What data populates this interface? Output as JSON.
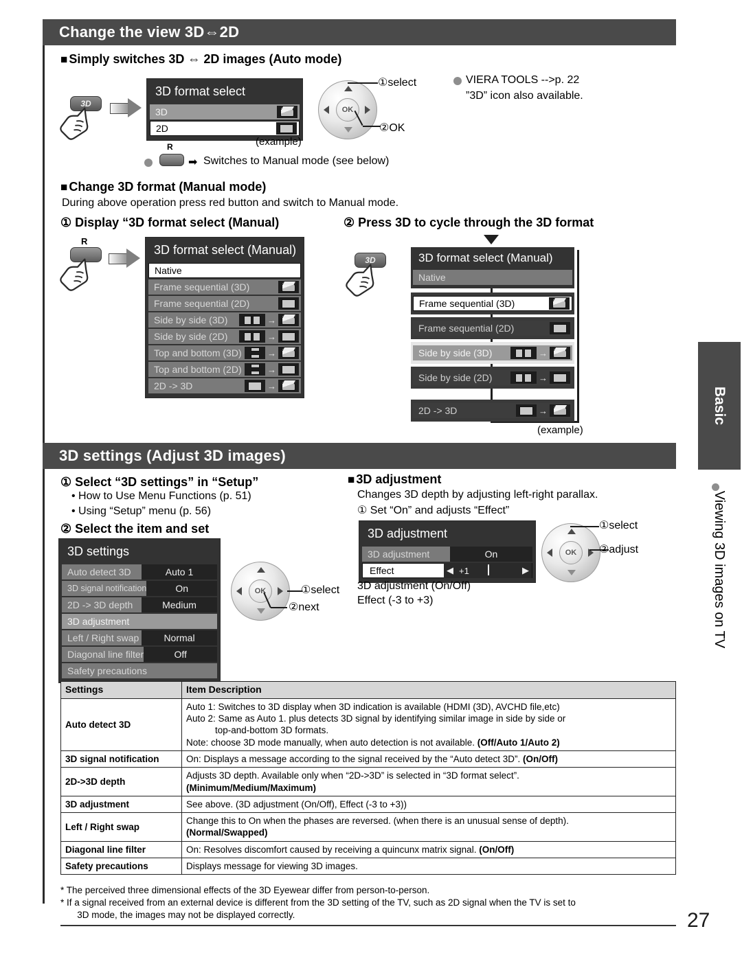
{
  "page": {
    "number": "27"
  },
  "side": {
    "tab_label": "Basic",
    "vertical_label": "Viewing 3D images on TV"
  },
  "section1": {
    "title": "Change the view 3D⇔2D",
    "sub1": "Simply switches 3D ⇔ 2D images (Auto mode)",
    "osd_auto": {
      "title": "3D format select",
      "rows": [
        {
          "label": "3D",
          "glyph": "cube-icon"
        },
        {
          "label": "2D",
          "glyph": "flat-icon"
        }
      ],
      "caption": "(example)"
    },
    "wheel1": {
      "ok_label": "OK",
      "callout1": "①select",
      "callout2": "②OK"
    },
    "note_viera": "VIERA TOOLS -->p. 22",
    "note_viera2": "”3D” icon also available.",
    "red_button_label": "R",
    "switch_manual_text": "Switches to Manual mode (see below)",
    "button_3d_label": "3D",
    "sub2": "Change 3D format (Manual mode)",
    "sub2_body": "During above operation press red button and switch to Manual mode.",
    "step1": "① Display “3D format select (Manual)",
    "step2": "② Press 3D to cycle through the 3D format",
    "osd_manual": {
      "title": "3D format select (Manual)",
      "rows": [
        {
          "label": "Native",
          "style": "selected",
          "glyphs": []
        },
        {
          "label": "Frame sequential (3D)",
          "style": "normal",
          "glyphs": [
            "cube-icon"
          ]
        },
        {
          "label": "Frame sequential (2D)",
          "style": "normal",
          "glyphs": [
            "flat-icon"
          ]
        },
        {
          "label": "Side by side (3D)",
          "style": "normal",
          "glyphs": [
            "half-half-icon",
            "arrow-icon",
            "cube-icon"
          ]
        },
        {
          "label": "Side by side (2D)",
          "style": "normal",
          "glyphs": [
            "half-half-icon",
            "arrow-icon",
            "flat-icon"
          ]
        },
        {
          "label": "Top and bottom (3D)",
          "style": "normal",
          "glyphs": [
            "stack-icon",
            "arrow-icon",
            "cube-icon"
          ]
        },
        {
          "label": "Top and bottom (2D)",
          "style": "normal",
          "glyphs": [
            "stack-icon",
            "arrow-icon",
            "flat-icon"
          ]
        },
        {
          "label": "2D -> 3D",
          "style": "normal",
          "glyphs": [
            "flat-icon",
            "arrow-icon",
            "cube-icon"
          ]
        }
      ]
    },
    "osd_cycle": {
      "title": "3D format select (Manual)",
      "rows": [
        {
          "label": "Native",
          "style": "normal",
          "glyphs": []
        },
        {
          "label": "Frame sequential (3D)",
          "style": "selected",
          "glyphs": [
            "cube-icon"
          ]
        },
        {
          "label": "Frame sequential (2D)",
          "style": "normal",
          "glyphs": [
            "flat-icon"
          ]
        },
        {
          "label": "Side by side (3D)",
          "style": "hl",
          "glyphs": [
            "half-half-icon",
            "arrow-icon",
            "cube-icon"
          ]
        },
        {
          "label": "Side by side (2D)",
          "style": "normal",
          "glyphs": [
            "half-half-icon",
            "arrow-icon",
            "flat-icon"
          ]
        },
        {
          "label": "2D -> 3D",
          "style": "normal",
          "glyphs": [
            "flat-icon",
            "arrow-icon",
            "cube-icon"
          ]
        }
      ],
      "caption": "(example)",
      "ellipsis": "⋮"
    }
  },
  "section2": {
    "title": "3D settings (Adjust 3D images)",
    "step1": "① Select “3D settings” in “Setup”",
    "bullet1": "• How to Use Menu Functions (p. 51)",
    "bullet2": "• Using “Setup” menu (p. 56)",
    "step2": "② Select the item and set",
    "osd_settings": {
      "title": "3D settings",
      "rows": [
        {
          "label": "Auto detect 3D",
          "value": "Auto 1"
        },
        {
          "label": "3D signal notification",
          "value": "On"
        },
        {
          "label": "2D -> 3D depth",
          "value": "Medium"
        },
        {
          "label": "3D adjustment",
          "value": ""
        },
        {
          "label": "Left / Right swap",
          "value": "Normal"
        },
        {
          "label": "Diagonal line filter",
          "value": "Off"
        },
        {
          "label": "Safety precautions",
          "value": ""
        }
      ]
    },
    "wheel2": {
      "ok_label": "OK",
      "callout1": "①select",
      "callout2": "②next"
    },
    "adj_heading": "3D adjustment",
    "adj_line1": "Changes 3D depth by adjusting left-right parallax.",
    "adj_line2": "① Set “On” and adjusts “Effect”",
    "osd_adjust": {
      "title": "3D adjustment",
      "row_label": "3D adjustment",
      "row_value": "On",
      "effect_label": "Effect",
      "effect_value": "+1",
      "left_arrow": "◀",
      "right_arrow": "▶"
    },
    "wheel3": {
      "ok_label": "OK",
      "callout1": "①select",
      "callout2": "②adjust"
    },
    "adj_note1": "3D adjustment (On/Off)",
    "adj_note2": "Effect (-3 to +3)"
  },
  "table": {
    "headers": [
      "Settings",
      "Item Description"
    ],
    "rows": [
      {
        "key": "Auto detect 3D",
        "lines": [
          {
            "text": "Auto 1: Switches to 3D display when 3D indication is available (HDMI (3D), AVCHD file,etc)",
            "indent": false,
            "bold_tail": ""
          },
          {
            "text": "Auto 2: Same as Auto 1. plus detects 3D signal by identifying similar image in side by side or",
            "indent": false,
            "bold_tail": ""
          },
          {
            "text": "top-and-bottom 3D formats.",
            "indent": true,
            "bold_tail": ""
          },
          {
            "text": "Note: choose 3D mode manually, when auto detection is not available. ",
            "indent": false,
            "bold_tail": "(Off/Auto 1/Auto 2)"
          }
        ]
      },
      {
        "key": "3D signal notification",
        "lines": [
          {
            "text": "On: Displays a message according to the signal received by the “Auto detect 3D”. ",
            "indent": false,
            "bold_tail": "(On/Off)"
          }
        ]
      },
      {
        "key": "2D->3D depth",
        "lines": [
          {
            "text": "Adjusts 3D depth. Available only when “2D->3D” is selected in “3D format select”.",
            "indent": false,
            "bold_tail": ""
          },
          {
            "text": "",
            "indent": false,
            "bold_tail": "(Minimum/Medium/Maximum)"
          }
        ]
      },
      {
        "key": "3D adjustment",
        "lines": [
          {
            "text": "See above. (3D adjustment (On/Off), Effect (-3 to +3))",
            "indent": false,
            "bold_tail": ""
          }
        ]
      },
      {
        "key": "Left / Right swap",
        "lines": [
          {
            "text": "Change this to On when the phases are reversed. (when there is an unusual sense of depth).",
            "indent": false,
            "bold_tail": ""
          },
          {
            "text": "",
            "indent": false,
            "bold_tail": "(Normal/Swapped)"
          }
        ]
      },
      {
        "key": "Diagonal line filter",
        "lines": [
          {
            "text": "On: Resolves discomfort caused by receiving a quincunx matrix signal. ",
            "indent": false,
            "bold_tail": "(On/Off)"
          }
        ]
      },
      {
        "key": "Safety precautions",
        "lines": [
          {
            "text": "Displays message for viewing 3D images.",
            "indent": false,
            "bold_tail": ""
          }
        ]
      }
    ]
  },
  "notes": [
    "* The perceived three dimensional effects of the 3D Eyewear differ from person-to-person.",
    "* If a signal received from an external device is different from the 3D setting of the TV, such as 2D signal when the TV is set to\n   3D mode, the images may not be displayed correctly."
  ]
}
